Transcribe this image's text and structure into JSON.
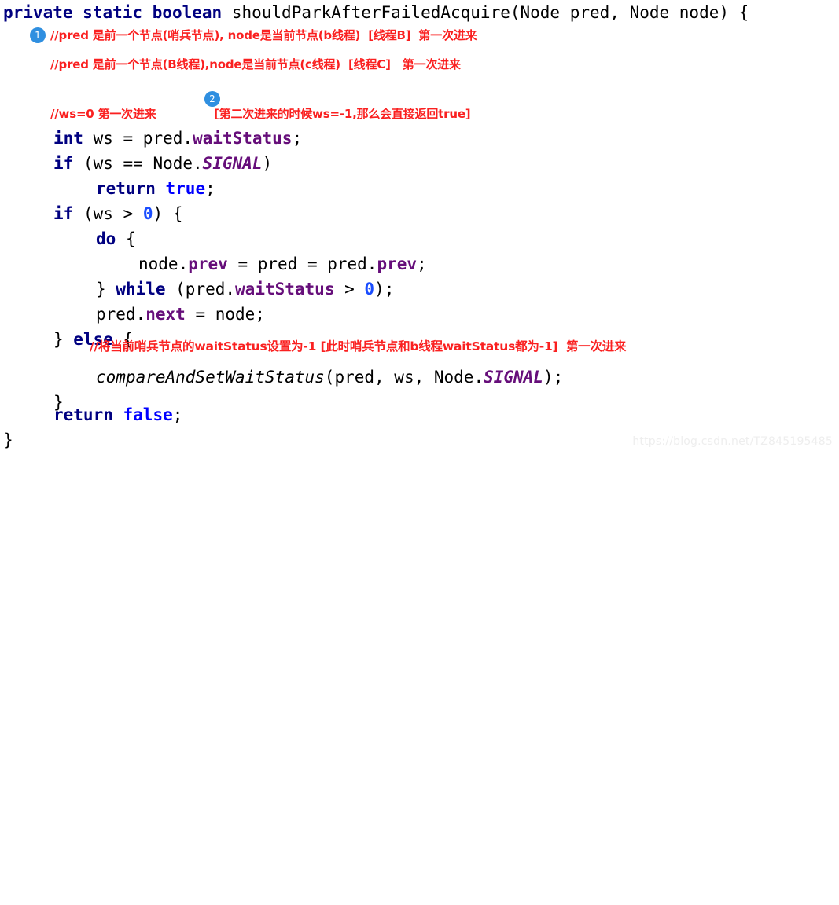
{
  "snippet": {
    "language": "java",
    "method_signature": "private static boolean shouldParkAfterFailedAcquire(Node pred, Node node) {",
    "lines": {
      "l1_kw_private": "private",
      "l1_kw_static": "static",
      "l1_kw_boolean": "boolean",
      "l1_rest": " shouldParkAfterFailedAcquire(Node pred, Node node) {",
      "l2_kw_int": "int",
      "l2_mid": " ws = pred.",
      "l2_fld": "waitStatus",
      "l2_end": ";",
      "l3_kw_if": "if",
      "l3_mid": " (ws == Node.",
      "l3_const": "SIGNAL",
      "l3_end": ")",
      "l4_kw_return": "return",
      "l4_lit": "true",
      "l4_end": ";",
      "l5_kw_if": "if",
      "l5_mid": " (ws > ",
      "l5_num": "0",
      "l5_end": ") {",
      "l6_kw_do": "do",
      "l6_end": " {",
      "l7_a": "node.",
      "l7_fld1": "prev",
      "l7_b": " = pred = pred.",
      "l7_fld2": "prev",
      "l7_end": ";",
      "l8_brace": "} ",
      "l8_kw_while": "while",
      "l8_mid": " (pred.",
      "l8_fld": "waitStatus",
      "l8_mid2": " > ",
      "l8_num": "0",
      "l8_end": ");",
      "l9_a": "pred.",
      "l9_fld": "next",
      "l9_end": " = node;",
      "l10_brace": "} ",
      "l10_kw_else": "else",
      "l10_end": " {",
      "l11_mth": "compareAndSetWaitStatus",
      "l11_mid": "(pred, ws, Node.",
      "l11_const": "SIGNAL",
      "l11_end": ");",
      "l12_close": "}",
      "l13_kw_return": "return",
      "l13_lit": "false",
      "l13_end": ";",
      "l14_close": "}"
    }
  },
  "annotations": {
    "badges": [
      {
        "label": "1"
      },
      {
        "label": "2"
      }
    ],
    "comments": [
      {
        "text": "//pred 是前一个节点(哨兵节点), node是当前节点(b线程)  [线程B]  第一次进来"
      },
      {
        "text": "//pred 是前一个节点(B线程),node是当前节点(c线程)  [线程C]   第一次进来"
      },
      {
        "text": "//ws=0 第一次进来"
      },
      {
        "text": "[第二次进来的时候ws=-1,那么会直接返回true]"
      },
      {
        "text": "//将当前哨兵节点的waitStatus设置为-1 [此时哨兵节点和b线程waitStatus都为-1]  第一次进来"
      }
    ]
  },
  "watermark": {
    "text": "https://blog.csdn.net/TZ845195485"
  },
  "colors": {
    "background": "#ffffff",
    "keyword": "#000080",
    "literal": "#0000ff",
    "field": "#660e7a",
    "comment": "#fa2020",
    "badge": "#2f8fe0",
    "watermark": "#eeeeee",
    "plain": "#000000"
  }
}
